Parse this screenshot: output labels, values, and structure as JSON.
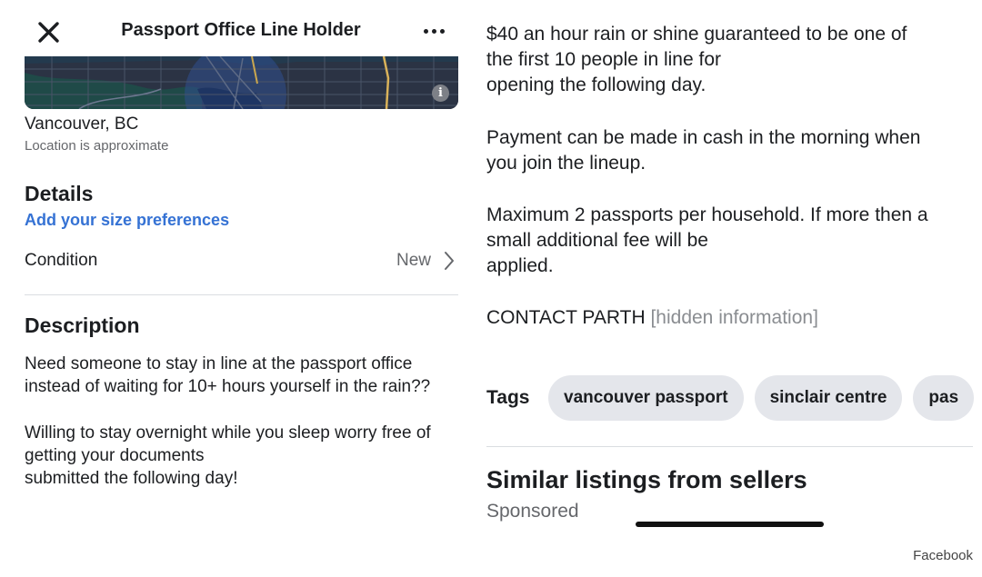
{
  "header": {
    "title": "Passport Office Line Holder",
    "close_icon": "close-icon",
    "more_icon": "more-horizontal-icon"
  },
  "map": {
    "info_glyph": "i"
  },
  "location": {
    "name": "Vancouver, BC",
    "note": "Location is approximate"
  },
  "details": {
    "heading": "Details",
    "size_link": "Add your size preferences",
    "condition_label": "Condition",
    "condition_value": "New"
  },
  "description": {
    "heading": "Description",
    "paragraph_1": "Need someone to stay in line at the passport office\ninstead of waiting for 10+ hours yourself in the rain??",
    "paragraph_2": "Willing to stay overnight while you sleep worry free of\ngetting your documents\nsubmitted the following day!",
    "paragraph_3": "$40 an hour rain or shine guaranteed to be one of\nthe first 10 people in line for\nopening the following day.",
    "paragraph_4": "Payment can be made in cash in the morning when\nyou join the lineup.",
    "paragraph_5": "Maximum 2 passports per household. If more then a\nsmall additional fee will be\napplied.",
    "contact_prefix": "CONTACT PARTH",
    "contact_hidden": "[hidden information]"
  },
  "tags": {
    "label": "Tags",
    "items": [
      "vancouver passport",
      "sinclair centre",
      "pas"
    ]
  },
  "similar": {
    "heading": "Similar listings from sellers",
    "sponsored": "Sponsored"
  },
  "watermark": "Facebook",
  "colors": {
    "link": "#3572d4",
    "muted": "#65676b",
    "tag_bg": "#e4e6eb",
    "divider": "#dadde1"
  }
}
